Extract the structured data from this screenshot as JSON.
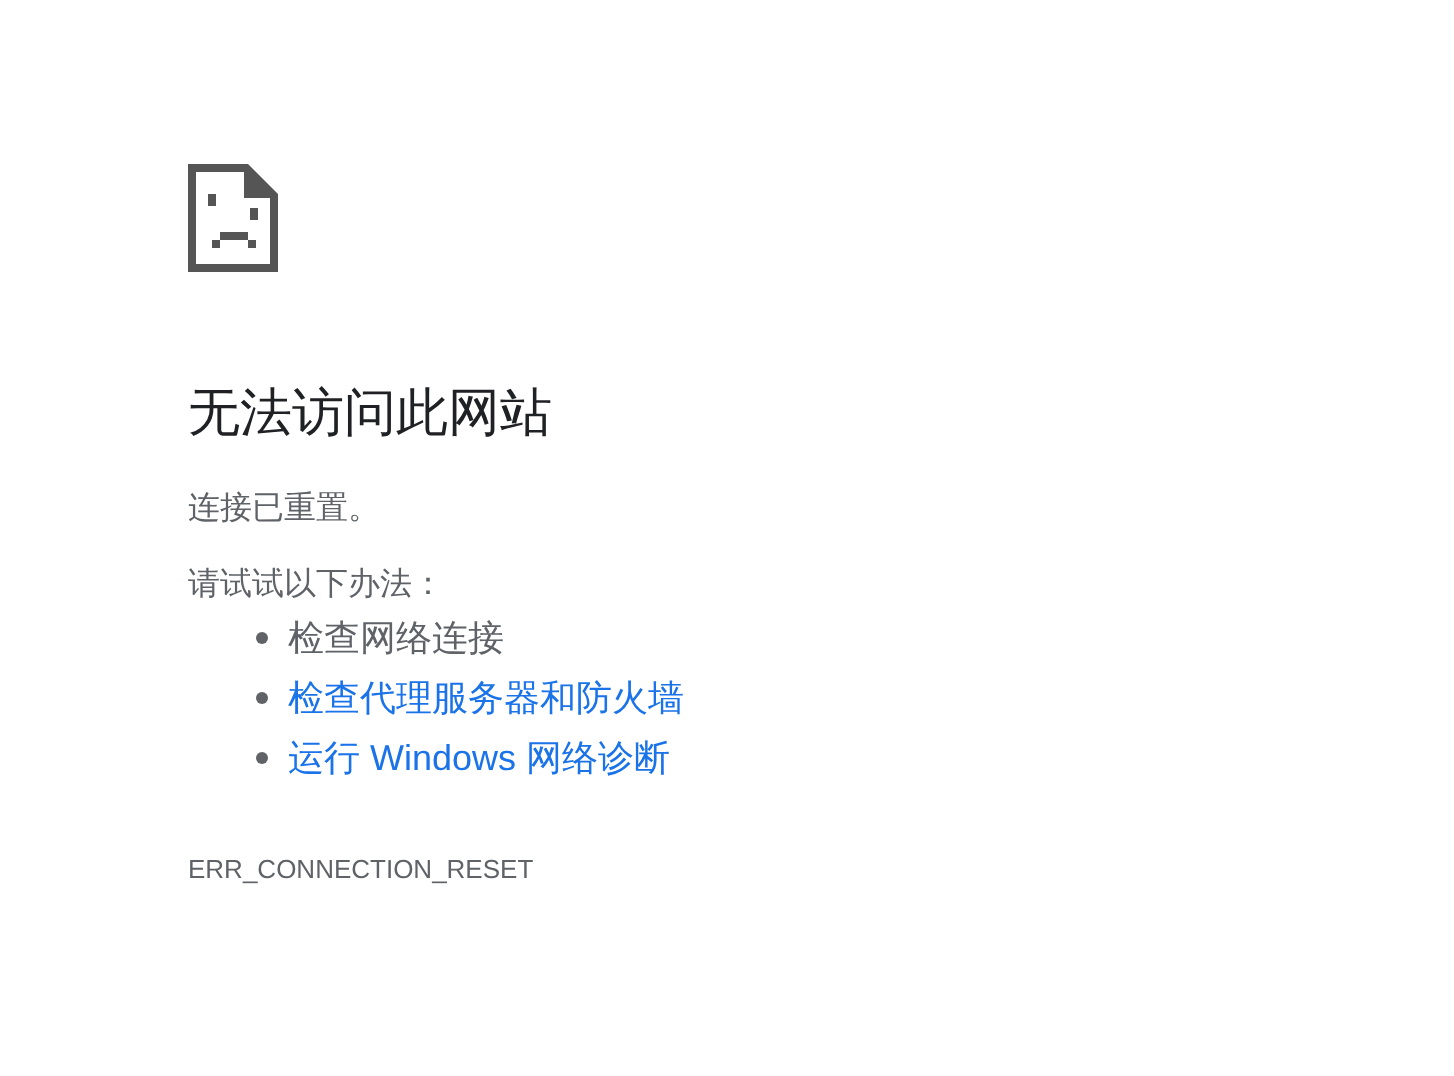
{
  "heading": "无法访问此网站",
  "summary": "连接已重置。",
  "suggestions_intro": "请试试以下办法：",
  "suggestions": [
    {
      "kind": "text",
      "label": "检查网络连接"
    },
    {
      "kind": "link",
      "label": "检查代理服务器和防火墙"
    },
    {
      "kind": "link",
      "label": "运行 Windows 网络诊断"
    }
  ],
  "error_code": "ERR_CONNECTION_RESET"
}
